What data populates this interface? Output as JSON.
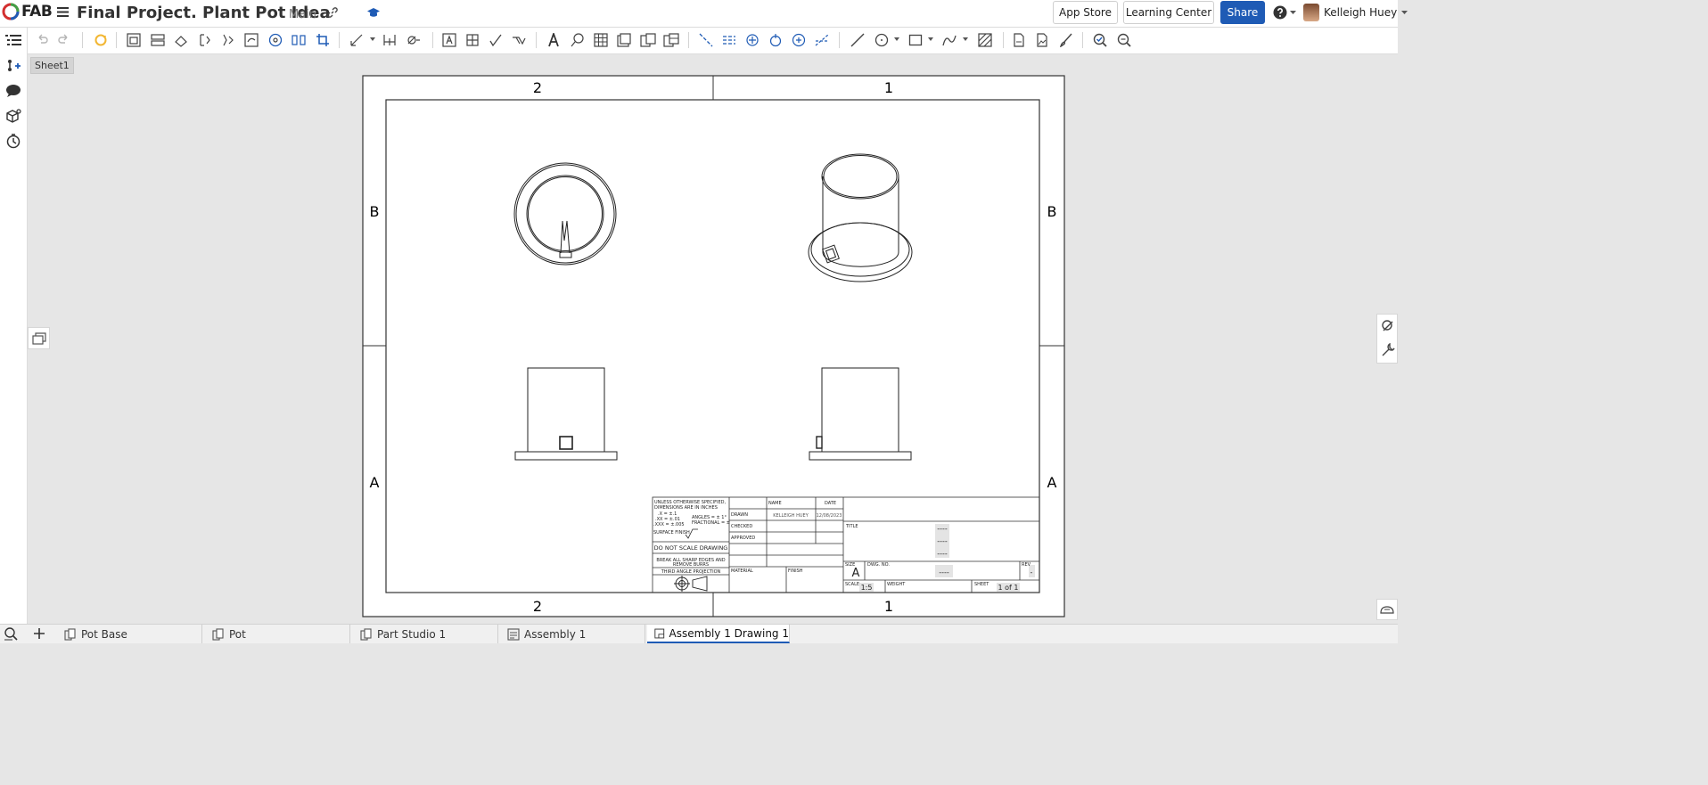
{
  "app": {
    "logo_text": "FAB",
    "document_title": "Final Project. Plant Pot Idea",
    "branch": "Main"
  },
  "header": {
    "app_store": "App Store",
    "learning_center": "Learning Center",
    "share": "Share",
    "help_icon": "question-circle-icon",
    "user_name": "Kelleigh Huey"
  },
  "sheet_tab": "Sheet1",
  "drawing": {
    "zone_columns_top": [
      "2",
      "1"
    ],
    "zone_columns_bottom": [
      "2",
      "1"
    ],
    "zone_rows_left": [
      "B",
      "A"
    ],
    "zone_rows_right": [
      "B",
      "A"
    ],
    "title_block": {
      "tolerance_note_1": "UNLESS OTHERWISE SPECIFIED,",
      "tolerance_note_2": "DIMENSIONS ARE IN INCHES",
      "tol_x": ".X = ±.1",
      "tol_xx": ".XX = ±.01",
      "tol_xxx": ".XXX = ±.005",
      "angles": "ANGLES = ± 1°",
      "fractional": "FRACTIONAL = ±",
      "surface_finish": "SURFACE FINISH",
      "do_not_scale": "DO NOT SCALE DRAWING",
      "break_edges_1": "BREAK ALL SHARP EDGES AND",
      "break_edges_2": "REMOVE BURRS",
      "projection": "THIRD ANGLE PROJECTION",
      "col_name": "NAME",
      "col_date": "DATE",
      "row_drawn": "DRAWN",
      "row_checked": "CHECKED",
      "row_approved": "APPROVED",
      "drawn_name": "KELLEIGH HUEY",
      "drawn_date": "12/08/2023",
      "material": "MATERIAL",
      "finish": "FINISH",
      "title_label": "TITLE",
      "title_lines": [
        "----",
        "----",
        "----"
      ],
      "size_label": "SIZE",
      "size_value": "A",
      "dwg_no_label": "DWG. NO.",
      "dwg_no_value": "----",
      "rev_label": "REV",
      "rev_value": "-",
      "scale_label": "SCALE",
      "scale_value": "1:5",
      "weight_label": "WEIGHT",
      "sheet_label": "SHEET",
      "sheet_value": "1 of 1"
    }
  },
  "bottom_tabs": [
    {
      "label": "Pot Base",
      "icon": "part-studio-icon"
    },
    {
      "label": "Pot",
      "icon": "part-studio-icon"
    },
    {
      "label": "Part Studio 1",
      "icon": "part-studio-icon"
    },
    {
      "label": "Assembly 1",
      "icon": "assembly-icon"
    },
    {
      "label": "Assembly 1 Drawing 1",
      "icon": "drawing-icon",
      "active": true
    }
  ],
  "colors": {
    "accent": "#1f5bb5",
    "canvas": "#e6e6e6",
    "sheet": "#ffffff",
    "logo_red": "#d32f2f",
    "logo_green": "#43a047",
    "refresh_icon": "#f2b632"
  }
}
